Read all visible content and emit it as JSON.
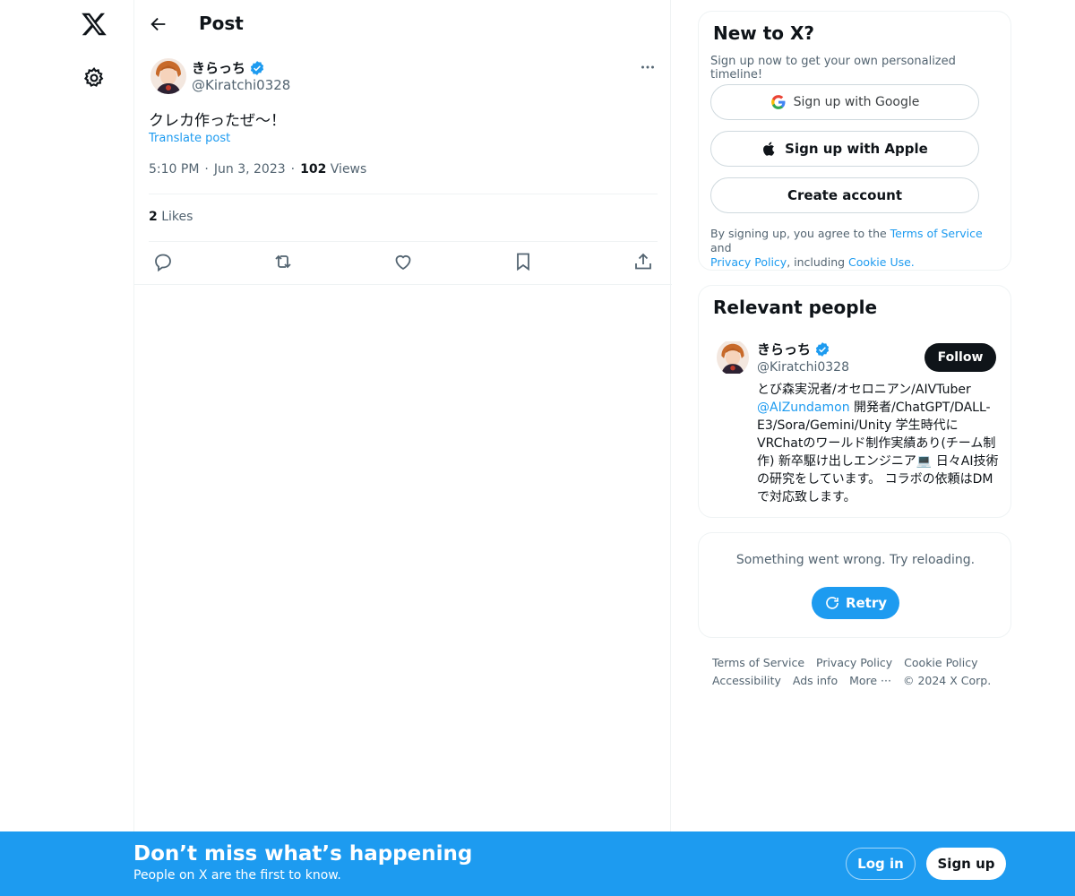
{
  "header": {
    "title": "Post"
  },
  "tweet": {
    "author_name": "きらっち",
    "author_handle": "@Kiratchi0328",
    "text": "クレカ作ったぜ〜！",
    "translate_label": "Translate post",
    "time": "5:10 PM",
    "date": "Jun 3, 2023",
    "views_count": "102",
    "views_label": "Views",
    "likes_count": "2",
    "likes_label": "Likes"
  },
  "signup_card": {
    "title": "New to X?",
    "subtitle": "Sign up now to get your own personalized timeline!",
    "google_label": "Sign up with Google",
    "apple_label": "Sign up with Apple",
    "create_label": "Create account",
    "legal_prefix": "By signing up, you agree to the",
    "terms_link": "Terms of Service",
    "and_text": "and",
    "privacy_link": "Privacy Policy",
    "including_text": ", including",
    "cookie_link": "Cookie Use."
  },
  "relevant": {
    "title": "Relevant people",
    "name": "きらっち",
    "handle": "@Kiratchi0328",
    "follow_label": "Follow",
    "bio_before": "とび森実況者/オセロニアン/AIVTuber",
    "bio_mention": "@AIZundamon",
    "bio_after": " 開発者/ChatGPT/DALL-E3/Sora/Gemini/Unity 学生時代にVRChatのワールド制作実績あり(チーム制作) 新卒駆け出しエンジニア💻 日々AI技術の研究をしています。 コラボの依頼はDMで対応致します。"
  },
  "error_card": {
    "message": "Something went wrong. Try reloading.",
    "retry_label": "Retry"
  },
  "footer": {
    "links": [
      "Terms of Service",
      "Privacy Policy",
      "Cookie Policy",
      "Accessibility",
      "Ads info",
      "More ···",
      "© 2024 X Corp."
    ]
  },
  "banner": {
    "title": "Don’t miss what’s happening",
    "subtitle": "People on X are the first to know.",
    "login_label": "Log in",
    "signup_label": "Sign up"
  },
  "colors": {
    "accent": "#1d9bf0",
    "text": "#0f1419",
    "muted": "#536471",
    "border": "#eff3f4"
  },
  "icons": [
    "x-logo-icon",
    "gear-icon",
    "back-arrow-icon",
    "verified-icon",
    "more-icon",
    "reply-icon",
    "repost-icon",
    "like-icon",
    "bookmark-icon",
    "share-icon",
    "google-icon",
    "apple-icon",
    "retry-icon"
  ]
}
